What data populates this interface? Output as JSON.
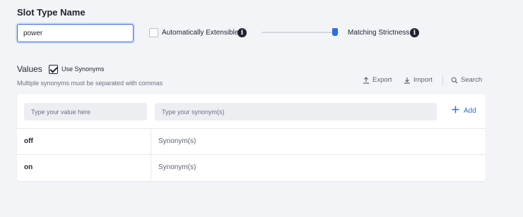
{
  "slot": {
    "title": "Slot Type Name",
    "name_value": "power"
  },
  "options": {
    "auto_extensible_label": "Automatically Extensible",
    "auto_extensible_checked": false,
    "matching_strictness_label": "Matching Strictness",
    "matching_strictness_level": 1.0
  },
  "values": {
    "title": "Values",
    "use_synonyms_label": "Use Synonyms",
    "use_synonyms_checked": true,
    "hint": "Multiple synonyms must be separated with commas",
    "toolbar": {
      "export_label": "Export",
      "import_label": "Import",
      "search_label": "Search"
    },
    "new_entry": {
      "value_placeholder": "Type your value here",
      "synonym_placeholder": "Type your synonym(s)",
      "add_label": "Add"
    },
    "rows": [
      {
        "value": "off",
        "synonyms": "Synonym(s)"
      },
      {
        "value": "on",
        "synonyms": "Synonym(s)"
      }
    ]
  },
  "icons": {
    "info": "info-icon",
    "export": "export-icon",
    "import": "import-icon",
    "search": "search-icon",
    "add": "plus-icon"
  },
  "colors": {
    "accent": "#2d6ee0",
    "text": "#1f2330",
    "muted": "#6b7180",
    "background": "#f3f4f7"
  }
}
